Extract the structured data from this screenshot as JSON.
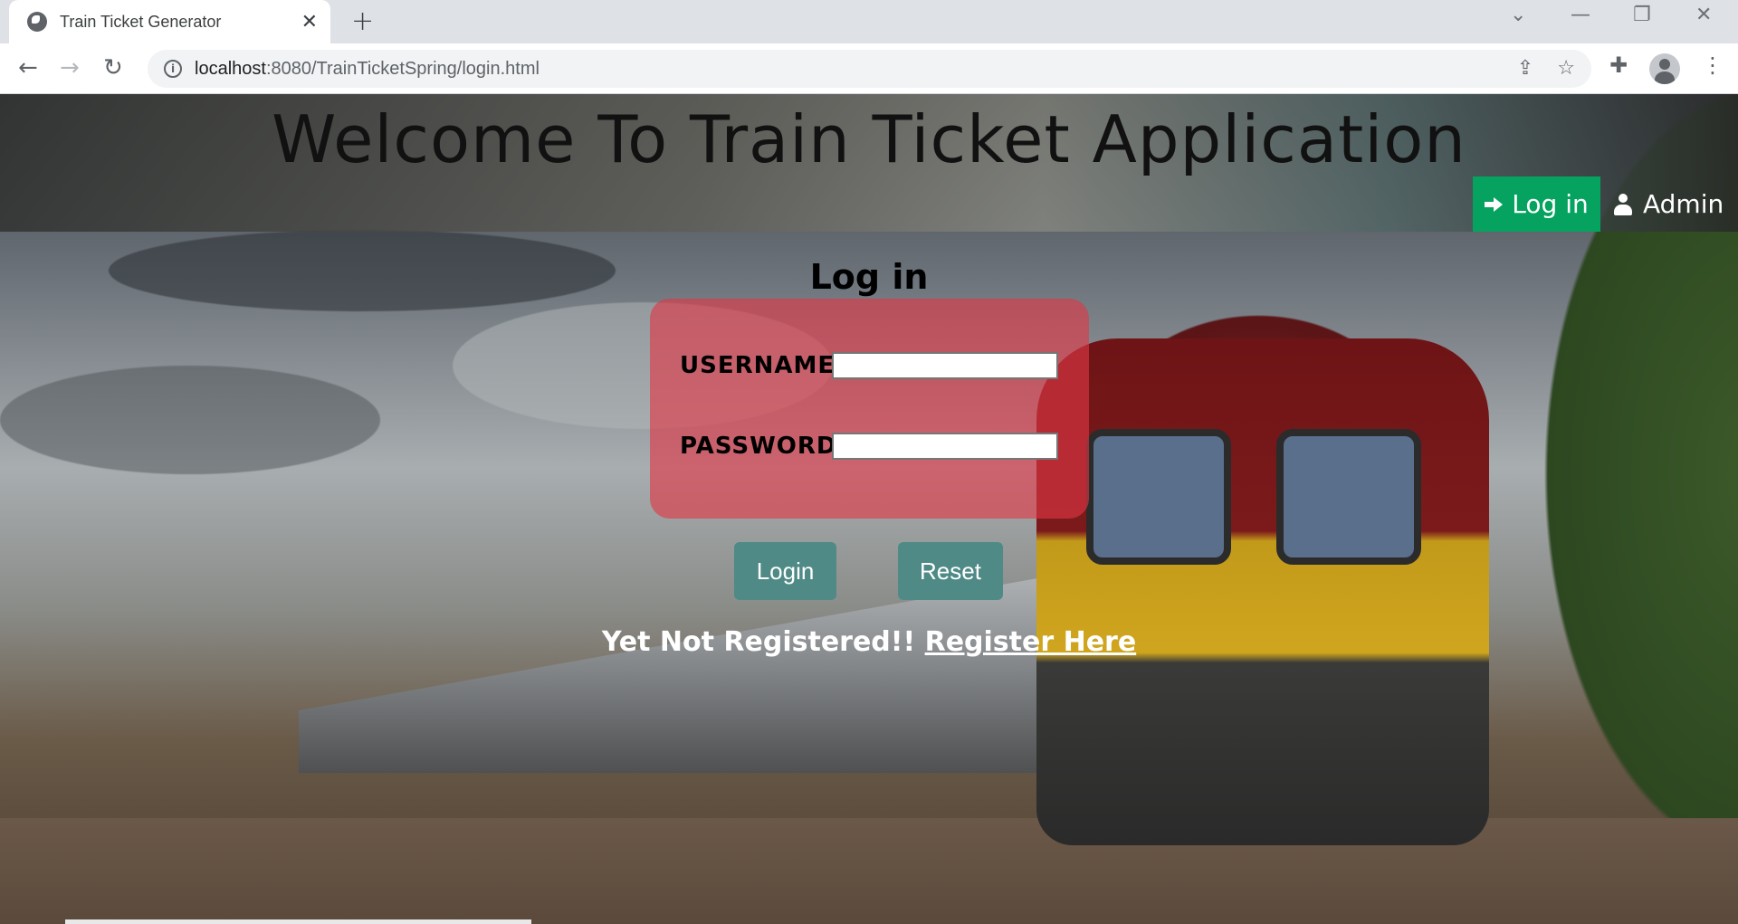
{
  "browser": {
    "tab_title": "Train Ticket Generator",
    "tab_close": "✕",
    "new_tab": "+",
    "url_host": "localhost",
    "url_path": ":8080/TrainTicketSpring/login.html",
    "controls": {
      "tab_search": "⌄",
      "minimize": "—",
      "restore": "❐",
      "close": "✕"
    },
    "nav": {
      "back": "←",
      "forward": "→",
      "reload": "↻"
    },
    "icons": {
      "share": "⇪",
      "bookmark": "☆",
      "extensions": "✚",
      "menu": "⋮"
    }
  },
  "header": {
    "title": "Welcome To Train Ticket Application",
    "nav_login": "Log in",
    "nav_admin": "Admin"
  },
  "login": {
    "title": "Log in",
    "username_label": "USERNAME:",
    "password_label": "PASSWORD:",
    "username_value": "",
    "password_value": "",
    "login_button": "Login",
    "reset_button": "Reset",
    "register_prompt": "Yet Not Registered!! ",
    "register_link": "Register Here"
  },
  "colors": {
    "nav_login_bg": "#05a35f",
    "login_box": "#e13746",
    "button_bg": "#4f8a86"
  }
}
